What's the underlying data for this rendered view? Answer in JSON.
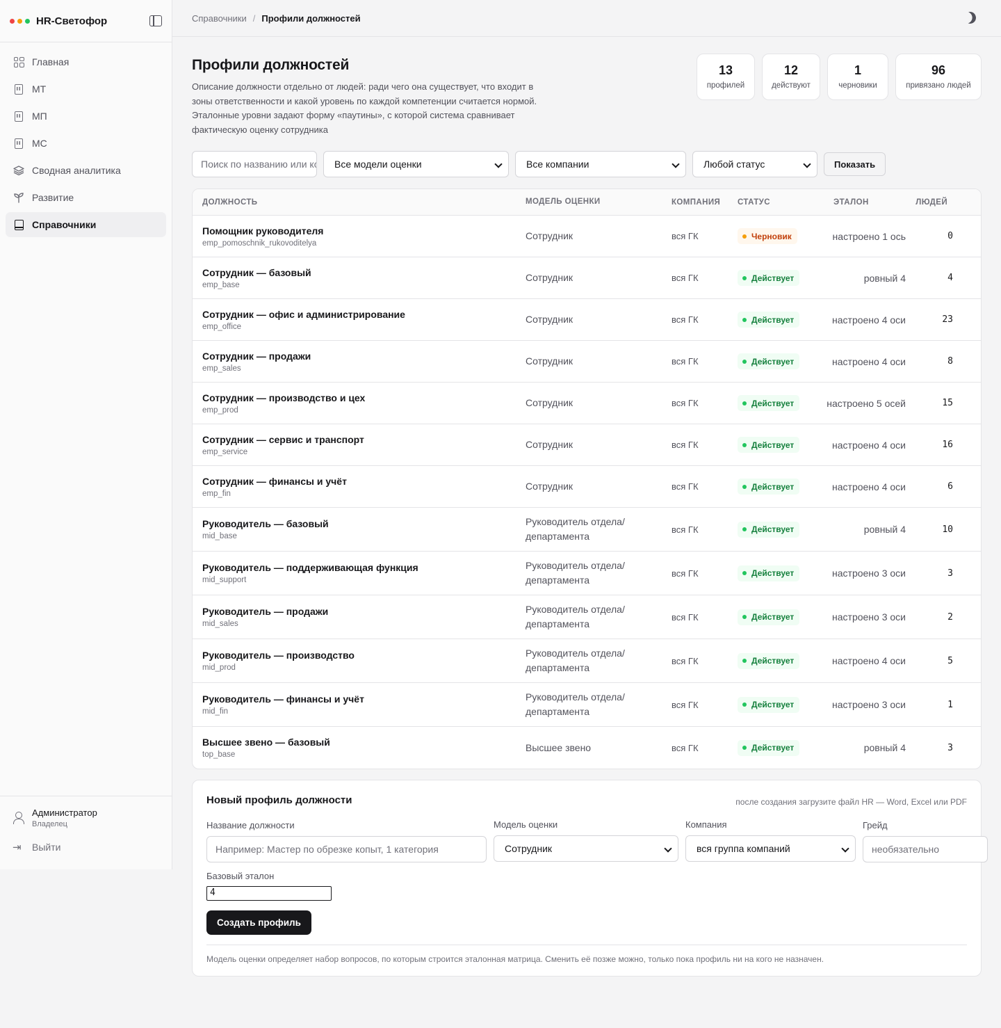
{
  "app": {
    "title": "HR-Светофор",
    "dots": [
      "#ef4444",
      "#f59e0b",
      "#22c55e"
    ]
  },
  "sidebar": {
    "items": [
      {
        "label": "Главная",
        "icon": "grid-icon"
      },
      {
        "label": "МТ",
        "icon": "building-icon"
      },
      {
        "label": "МП",
        "icon": "building-icon"
      },
      {
        "label": "МС",
        "icon": "building-icon"
      },
      {
        "label": "Сводная аналитика",
        "icon": "layers-icon"
      },
      {
        "label": "Развитие",
        "icon": "sprout-icon"
      },
      {
        "label": "Справочники",
        "icon": "book-icon",
        "active": true
      }
    ],
    "user": {
      "name": "Администратор",
      "role": "Владелец"
    },
    "logout": "Выйти"
  },
  "breadcrumb": {
    "parent": "Справочники",
    "separator": "/",
    "current": "Профили должностей"
  },
  "header": {
    "title": "Профили должностей",
    "description": "Описание должности отдельно от людей: ради чего она существует, что входит в зоны ответственности и какой уровень по каждой компетенции считается нормой. Эталонные уровни задают форму «паутины», с которой система сравнивает фактическую оценку сотрудника"
  },
  "stats": [
    {
      "value": "13",
      "label": "профилей"
    },
    {
      "value": "12",
      "label": "действуют"
    },
    {
      "value": "1",
      "label": "черновики"
    },
    {
      "value": "96",
      "label": "привязано людей"
    }
  ],
  "filters": {
    "search_placeholder": "Поиск по названию или коду",
    "model": "Все модели оценки",
    "company": "Все компании",
    "status": "Любой статус",
    "show_button": "Показать"
  },
  "table": {
    "columns": [
      "ДОЛЖНОСТЬ",
      "МОДЕЛЬ ОЦЕНКИ",
      "КОМПАНИЯ",
      "СТАТУС",
      "ЭТАЛОН",
      "ЛЮДЕЙ"
    ],
    "rows": [
      {
        "name": "Помощник руководителя",
        "slug": "emp_pomoschnik_rukovoditelya",
        "model": "Сотрудник",
        "company": "вся ГК",
        "status": "Черновик",
        "status_kind": "draft",
        "etalon": "настроено 1 ось",
        "people": "0"
      },
      {
        "name": "Сотрудник — базовый",
        "slug": "emp_base",
        "model": "Сотрудник",
        "company": "вся ГК",
        "status": "Действует",
        "status_kind": "active",
        "etalon": "ровный 4",
        "people": "4"
      },
      {
        "name": "Сотрудник — офис и администрирование",
        "slug": "emp_office",
        "model": "Сотрудник",
        "company": "вся ГК",
        "status": "Действует",
        "status_kind": "active",
        "etalon": "настроено 4 оси",
        "people": "23"
      },
      {
        "name": "Сотрудник — продажи",
        "slug": "emp_sales",
        "model": "Сотрудник",
        "company": "вся ГК",
        "status": "Действует",
        "status_kind": "active",
        "etalon": "настроено 4 оси",
        "people": "8"
      },
      {
        "name": "Сотрудник — производство и цех",
        "slug": "emp_prod",
        "model": "Сотрудник",
        "company": "вся ГК",
        "status": "Действует",
        "status_kind": "active",
        "etalon": "настроено 5 осей",
        "people": "15"
      },
      {
        "name": "Сотрудник — сервис и транспорт",
        "slug": "emp_service",
        "model": "Сотрудник",
        "company": "вся ГК",
        "status": "Действует",
        "status_kind": "active",
        "etalon": "настроено 4 оси",
        "people": "16"
      },
      {
        "name": "Сотрудник — финансы и учёт",
        "slug": "emp_fin",
        "model": "Сотрудник",
        "company": "вся ГК",
        "status": "Действует",
        "status_kind": "active",
        "etalon": "настроено 4 оси",
        "people": "6"
      },
      {
        "name": "Руководитель — базовый",
        "slug": "mid_base",
        "model": "Руководитель отдела/департамента",
        "company": "вся ГК",
        "status": "Действует",
        "status_kind": "active",
        "etalon": "ровный 4",
        "people": "10"
      },
      {
        "name": "Руководитель — поддерживающая функция",
        "slug": "mid_support",
        "model": "Руководитель отдела/департамента",
        "company": "вся ГК",
        "status": "Действует",
        "status_kind": "active",
        "etalon": "настроено 3 оси",
        "people": "3"
      },
      {
        "name": "Руководитель — продажи",
        "slug": "mid_sales",
        "model": "Руководитель отдела/департамента",
        "company": "вся ГК",
        "status": "Действует",
        "status_kind": "active",
        "etalon": "настроено 3 оси",
        "people": "2"
      },
      {
        "name": "Руководитель — производство",
        "slug": "mid_prod",
        "model": "Руководитель отдела/департамента",
        "company": "вся ГК",
        "status": "Действует",
        "status_kind": "active",
        "etalon": "настроено 4 оси",
        "people": "5"
      },
      {
        "name": "Руководитель — финансы и учёт",
        "slug": "mid_fin",
        "model": "Руководитель отдела/департамента",
        "company": "вся ГК",
        "status": "Действует",
        "status_kind": "active",
        "etalon": "настроено 3 оси",
        "people": "1"
      },
      {
        "name": "Высшее звено — базовый",
        "slug": "top_base",
        "model": "Высшее звено",
        "company": "вся ГК",
        "status": "Действует",
        "status_kind": "active",
        "etalon": "ровный 4",
        "people": "3"
      }
    ]
  },
  "status_colors": {
    "active": {
      "bg": "#f0fdf4",
      "fg": "#15803d",
      "dot": "#22c55e"
    },
    "draft": {
      "bg": "#fff7ed",
      "fg": "#c2410c",
      "dot": "#f59e0b"
    }
  },
  "create_form": {
    "title": "Новый профиль должности",
    "hint": "после создания загрузите файл HR — Word, Excel или PDF",
    "name_label": "Название должности",
    "name_placeholder": "Например: Мастер по обрезке копыт, 1 категория",
    "model_label": "Модель оценки",
    "model_value": "Сотрудник",
    "company_label": "Компания",
    "company_value": "вся группа компаний",
    "grade_label": "Грейд",
    "grade_placeholder": "необязательно",
    "etalon_label": "Базовый эталон",
    "etalon_value": "4",
    "submit": "Создать профиль",
    "note": "Модель оценки определяет набор вопросов, по которым строится эталонная матрица. Сменить её позже можно, только пока профиль ни на кого не назначен."
  }
}
